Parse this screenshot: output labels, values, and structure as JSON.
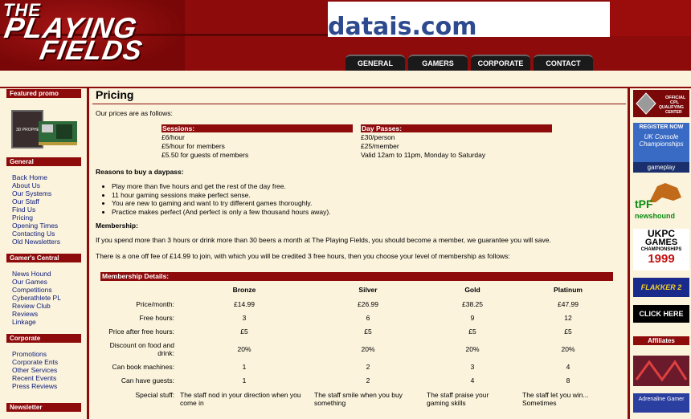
{
  "header": {
    "logo_line1": "THE",
    "logo_line2": "PLAYING",
    "logo_line3": "FIELDS",
    "banner_text": "datais.com",
    "nav": [
      "GENERAL",
      "GAMERS",
      "CORPORATE",
      "CONTACT"
    ]
  },
  "sidebar": {
    "featured_heading": "Featured promo",
    "promo_box_text": "3D PROPHET",
    "general_heading": "General",
    "general_links": [
      "Back Home",
      "About Us",
      "Our Systems",
      "Our Staff",
      "Find Us",
      "Pricing",
      "Opening Times",
      "Contacting Us",
      "Old Newsletters"
    ],
    "gamers_heading": "Gamer's Central",
    "gamers_links": [
      "News Hound",
      "Our Games",
      "Competitions",
      "Cyberathlete PL",
      "Review Club",
      "Reviews",
      "Linkage"
    ],
    "corporate_heading": "Corporate",
    "corporate_links": [
      "Promotions",
      "Corporate Ents",
      "Other Services",
      "Recent Events",
      "Press Reviews"
    ],
    "newsletter_heading": "Newsletter"
  },
  "main": {
    "title": "Pricing",
    "intro": "Our prices are as follows:",
    "sessions": {
      "heading": "Sessions:",
      "lines": [
        "£6/hour",
        "£5/hour for members",
        "£5.50 for guests of members"
      ]
    },
    "daypasses": {
      "heading": "Day Passes:",
      "lines": [
        "£30/person",
        "£25/member",
        "Valid 12am to 11pm, Monday to Saturday"
      ]
    },
    "reasons_heading": "Reasons to buy a daypass:",
    "reasons": [
      "Play more than five hours and get the rest of the day free.",
      "11 hour gaming sessions make perfect sense.",
      "You are new to gaming and want to try different games thoroughly.",
      "Practice makes perfect (And perfect is only a few thousand hours away)."
    ],
    "membership_heading": "Membership:",
    "membership_p1": "If you spend more than 3 hours or drink more than 30 beers a month at The Playing Fields, you should become a member, we guarantee you will save.",
    "membership_p2": "There is a one off fee of £14.99 to join, with which you will be credited 3 free hours, then you choose your level of membership as follows:",
    "details_heading": "Membership Details:",
    "tiers": [
      "Bronze",
      "Silver",
      "Gold",
      "Platinum"
    ],
    "rows": [
      {
        "label": "Price/month:",
        "values": [
          "£14.99",
          "£26.99",
          "£38.25",
          "£47.99"
        ]
      },
      {
        "label": "Free hours:",
        "values": [
          "3",
          "6",
          "9",
          "12"
        ]
      },
      {
        "label": "Price after free hours:",
        "values": [
          "£5",
          "£5",
          "£5",
          "£5"
        ]
      },
      {
        "label": "Discount on food and drink:",
        "values": [
          "20%",
          "20%",
          "20%",
          "20%"
        ]
      },
      {
        "label": "Can book machines:",
        "values": [
          "1",
          "2",
          "3",
          "4"
        ]
      },
      {
        "label": "Can have guests:",
        "values": [
          "1",
          "2",
          "4",
          "8"
        ]
      },
      {
        "label": "Special stuff:",
        "values": [
          "The staff nod in your direction when you come in",
          "The staff smile when you buy something",
          "The staff praise your gaming skills",
          "The staff let you win... Sometimes"
        ]
      }
    ]
  },
  "rightcol": {
    "cpl_text": "OFFICIAL CPL QUALIFYING CENTER",
    "register_now": "REGISTER NOW",
    "uk_console": "UK Console Championships",
    "gameplay": "gameplay",
    "tpf": "tPF",
    "newshound": "newshound",
    "ukpc_line1": "UKPC",
    "ukpc_line2": "GAMES",
    "ukpc_line3": "CHAMPIONSHIPS",
    "ukpc_year": "1999",
    "flakker": "FLAKKER 2",
    "click_here": "CLICK HERE",
    "affiliates": "Affiliates",
    "adrenaline": "Adrenaline Gamer"
  },
  "colors": {
    "brand_red": "#8d0b0b",
    "page_bg": "#fbf3dc",
    "link_blue": "#0b1b7a"
  }
}
